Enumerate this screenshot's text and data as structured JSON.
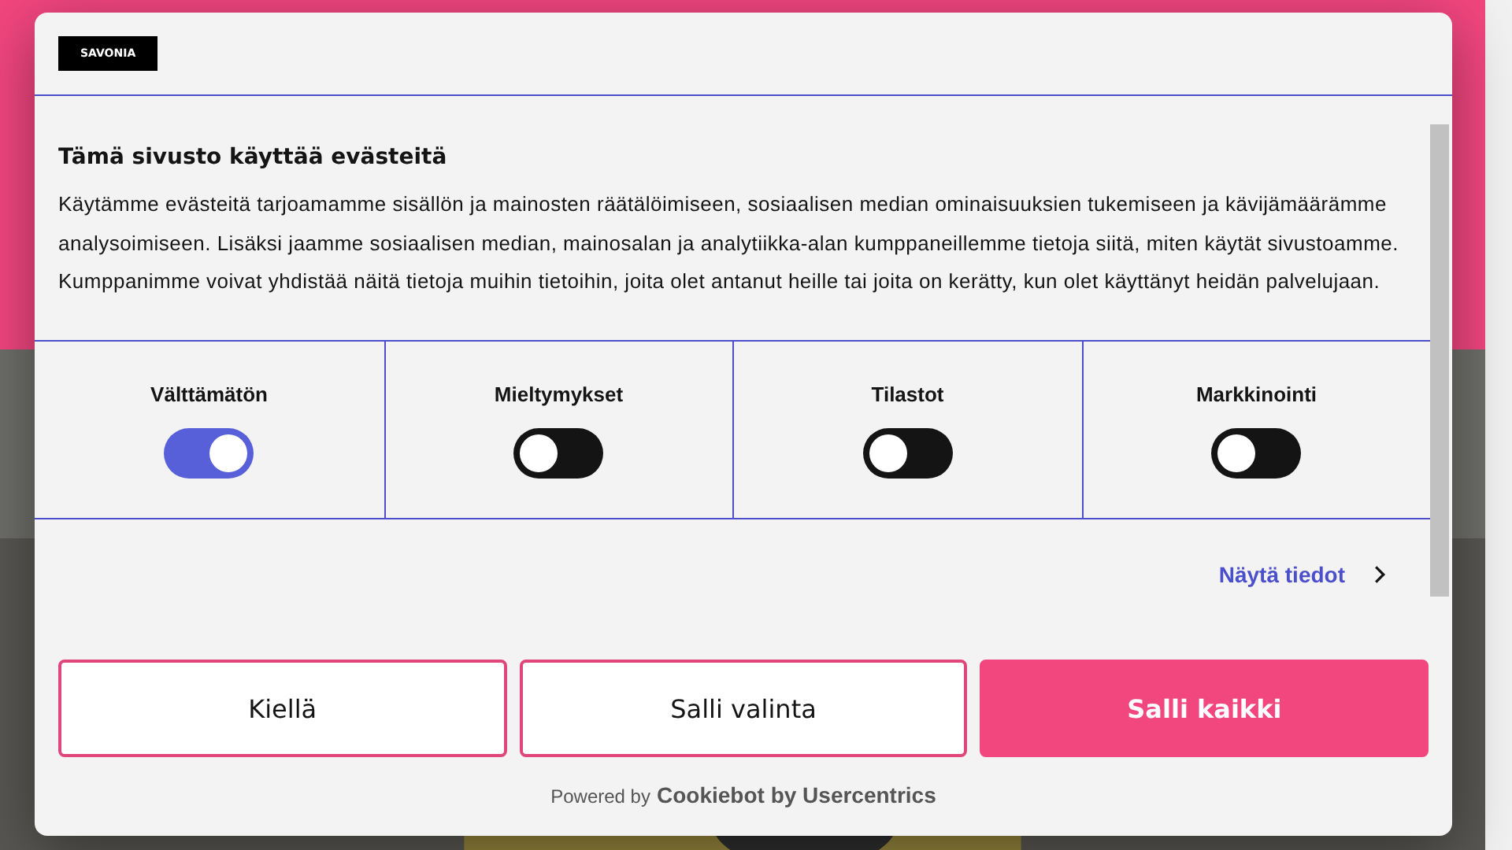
{
  "dialog": {
    "logo": "SAVONIA",
    "title": "Tämä sivusto käyttää evästeitä",
    "body": "Käytämme evästeitä tarjoamamme sisällön ja mainosten räätälöimiseen, sosiaalisen median ominaisuuksien tukemiseen ja kävijämäärämme analysoimiseen. Lisäksi jaamme sosiaalisen median, mainosalan ja analytiikka-alan kumppaneillemme tietoja siitä, miten käytät sivustoamme. Kumppanimme voivat yhdistää näitä tietoja muihin tietoihin, joita olet antanut heille tai joita on kerätty, kun olet käyttänyt heidän palvelujaan.",
    "categories": [
      {
        "label": "Välttämätön",
        "on": true
      },
      {
        "label": "Mieltymykset",
        "on": false
      },
      {
        "label": "Tilastot",
        "on": false
      },
      {
        "label": "Markkinointi",
        "on": false
      }
    ],
    "details_link": "Näytä tiedot",
    "buttons": [
      {
        "label": "Kiellä",
        "kind": "outline"
      },
      {
        "label": "Salli valinta",
        "kind": "outline"
      },
      {
        "label": "Salli kaikki",
        "kind": "primary"
      }
    ],
    "powered_by": "Powered by",
    "brand": "Cookiebot by Usercentrics"
  }
}
